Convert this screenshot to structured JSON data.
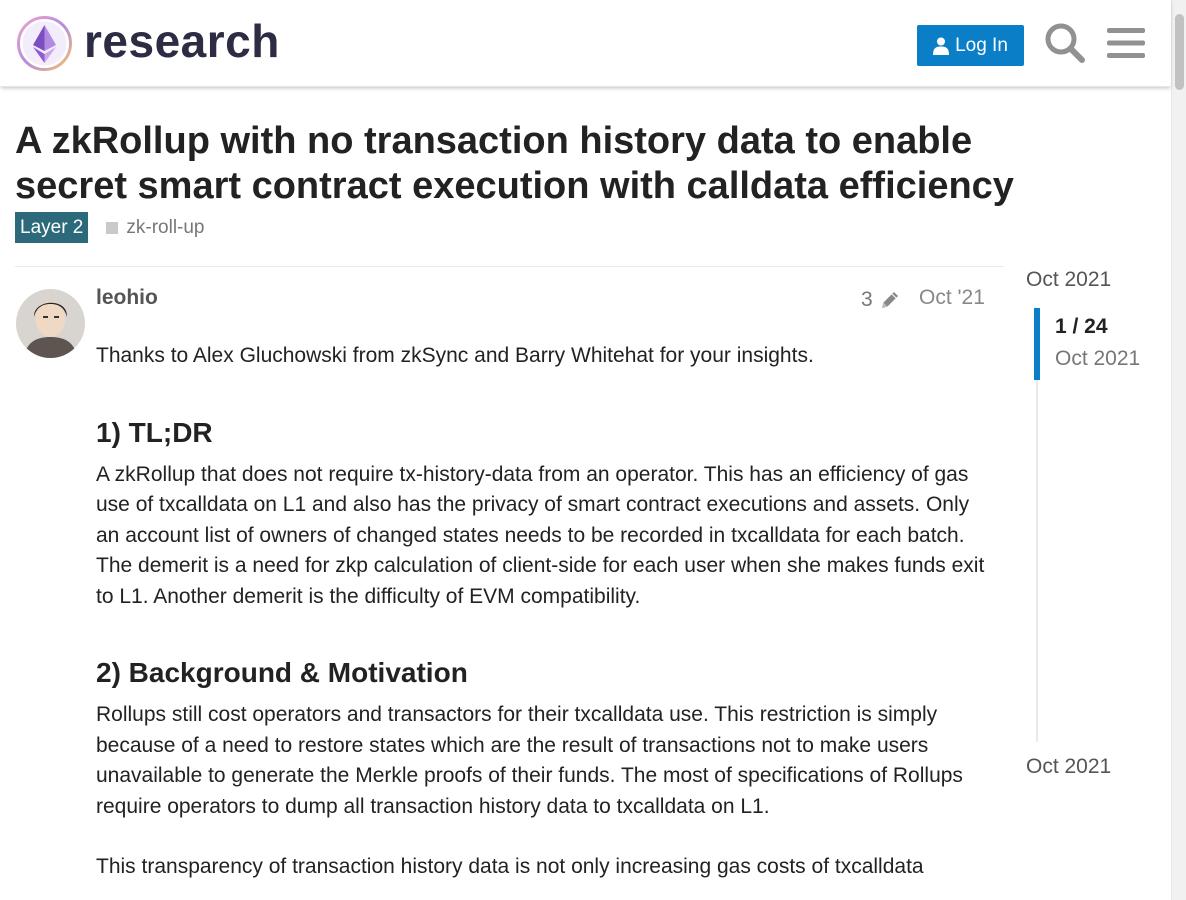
{
  "header": {
    "site_name": "research",
    "login_label": "Log In"
  },
  "topic": {
    "title": "A zkRollup with no transaction history data to enable secret smart contract execution with calldata efficiency",
    "category": "Layer 2",
    "category_color": "#2c6a7b",
    "tag": "zk-roll-up"
  },
  "post": {
    "username": "leohio",
    "edit_count": "3",
    "date": "Oct '21",
    "thanks": "Thanks to Alex Gluchowski from zkSync and Barry Whitehat for your insights.",
    "h1": "1) TL;DR",
    "tldr_p1": "A zkRollup that does not require tx-history-data from an operator. This has an efficiency of gas use of txcalldata on L1 and also has the privacy of smart contract executions and assets. Only an account list of owners of changed states needs to be recorded in txcalldata for each batch.",
    "tldr_p2": "The demerit is a need for zkp calculation of client-side for each user when she makes funds exit to L1. Another demerit is the difficulty of EVM compatibility.",
    "h2": "2) Background & Motivation",
    "bg_p1": "Rollups still cost operators and transactors for their txcalldata use. This restriction is simply because of a need to restore states which are the result of transactions not to make users unavailable to generate the Merkle proofs of their funds. The most of specifications of Rollups require operators to dump all transaction history data to txcalldata on L1.",
    "bg_p2": "This transparency of transaction history data is not only increasing gas costs of txcalldata"
  },
  "timeline": {
    "start_date": "Oct 2021",
    "counter": "1 / 24",
    "current_date": "Oct 2021",
    "end_date": "Oct 2021"
  },
  "colors": {
    "accent": "#0a7fc7",
    "text": "#222222"
  }
}
